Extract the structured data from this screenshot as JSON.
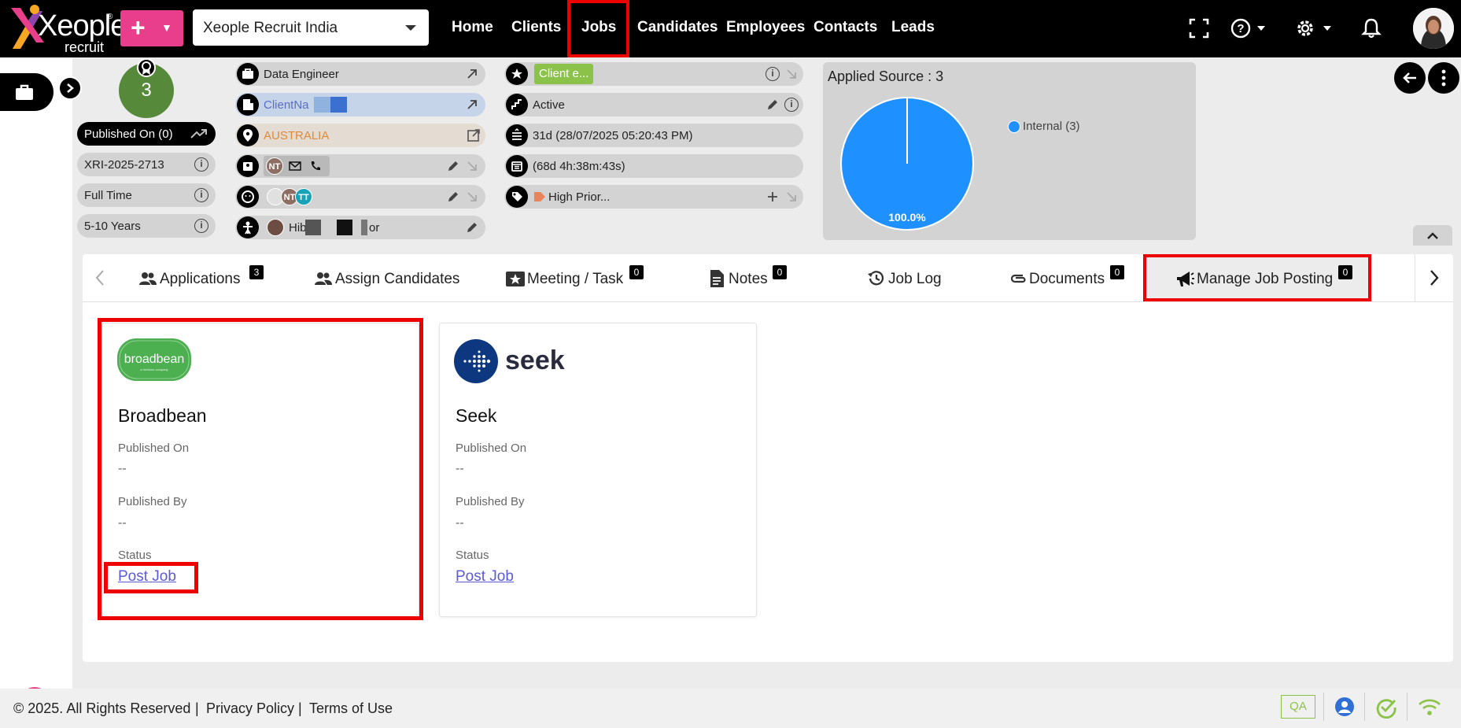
{
  "app": {
    "logo_word": "Xeople",
    "logo_sub": "recruit",
    "logo_reg": "®",
    "company_select": "Xeople Recruit India"
  },
  "nav": {
    "items": [
      {
        "label": "Home"
      },
      {
        "label": "Clients"
      },
      {
        "label": "Jobs"
      },
      {
        "label": "Candidates"
      },
      {
        "label": "Employees"
      },
      {
        "label": "Contacts"
      },
      {
        "label": "Leads"
      }
    ],
    "add_symbol": "+"
  },
  "job": {
    "score": "3",
    "published_on": "Published On (0)",
    "job_id": "XRI-2025-2713",
    "employment_type": "Full Time",
    "experience": "5-10 Years",
    "title": "Data Engineer",
    "client": "ClientNa",
    "location": "AUSTRALIA",
    "contact_avatar": "NT",
    "team_avatars": [
      "NT",
      "TT"
    ],
    "recruiter": "Hib",
    "recruiter_tail": "or",
    "stage_chip": "Client e...",
    "status": "Active",
    "age": "31d (28/07/2025 05:20:43 PM)",
    "time_left": "(68d 4h:38m:43s)",
    "priority": "High Prior..."
  },
  "applied_source": {
    "title": "Applied Source : 3",
    "legend": "Internal (3)",
    "slice_label": "100.0%",
    "slice_color": "#1e90ff"
  },
  "tabs": [
    {
      "label": "Applications",
      "badge": "3"
    },
    {
      "label": "Assign Candidates",
      "badge": ""
    },
    {
      "label": "Meeting / Task",
      "badge": "0"
    },
    {
      "label": "Notes",
      "badge": "0"
    },
    {
      "label": "Job Log",
      "badge": ""
    },
    {
      "label": "Documents",
      "badge": "0"
    },
    {
      "label": "Manage Job Posting",
      "badge": "0"
    }
  ],
  "boards": [
    {
      "logo_text": "broadbean",
      "logo_sub": "a Veritone company",
      "name": "Broadbean",
      "published_on_label": "Published On",
      "published_on_value": "--",
      "published_by_label": "Published By",
      "published_by_value": "--",
      "status_label": "Status",
      "action": "Post Job"
    },
    {
      "logo_text": "seek",
      "name": "Seek",
      "published_on_label": "Published On",
      "published_on_value": "--",
      "published_by_label": "Published By",
      "published_by_value": "--",
      "status_label": "Status",
      "action": "Post Job"
    }
  ],
  "footer": {
    "copyright": "© 2025. All Rights Reserved",
    "sep1": "|",
    "privacy": "Privacy Policy",
    "sep2": "|",
    "terms": "Terms of Use",
    "env_badge": "QA"
  },
  "colors": {
    "accent_pink": "#e83e8c",
    "score_green": "#568a3a",
    "highlight_red": "#ee0000",
    "chip_green": "#8bc34a",
    "link_purple": "#5b5bd6"
  }
}
